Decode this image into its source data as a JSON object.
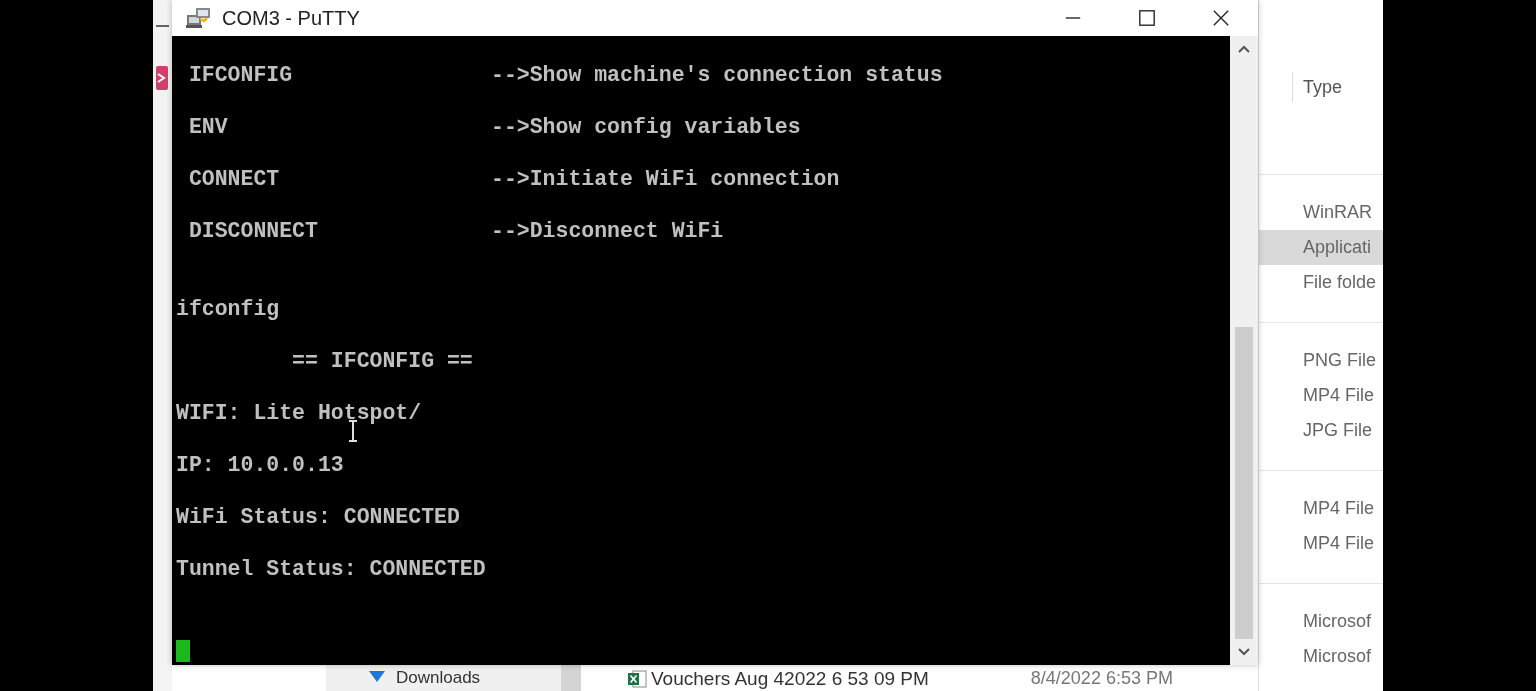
{
  "window": {
    "title": "COM3 - PuTTY"
  },
  "terminal": {
    "help_lines": [
      {
        "command": " IFCONFIG",
        "description": "-->Show machine's connection status"
      },
      {
        "command": " ENV",
        "description": "-->Show config variables"
      },
      {
        "command": " CONNECT",
        "description": "-->Initiate WiFi connection"
      },
      {
        "command": " DISCONNECT",
        "description": "-->Disconnect WiFi"
      }
    ],
    "output_lines": [
      "ifconfig",
      "         == IFCONFIG ==",
      "WIFI: Lite Hotspot/",
      "IP: 10.0.0.13",
      "WiFi Status: CONNECTED",
      "Tunnel Status: CONNECTED"
    ]
  },
  "explorer": {
    "column_header": "Type",
    "groups": [
      {
        "items": [
          {
            "label": "WinRAR",
            "selected": false
          },
          {
            "label": "Applicati",
            "selected": true
          },
          {
            "label": "File folde",
            "selected": false
          }
        ]
      },
      {
        "items": [
          {
            "label": "PNG File",
            "selected": false
          },
          {
            "label": "MP4 File",
            "selected": false
          },
          {
            "label": "JPG File",
            "selected": false
          }
        ]
      },
      {
        "items": [
          {
            "label": "MP4 File",
            "selected": false
          },
          {
            "label": "MP4 File",
            "selected": false
          }
        ]
      },
      {
        "items": [
          {
            "label": "Microsof",
            "selected": false
          },
          {
            "label": "Microsof",
            "selected": false
          }
        ]
      }
    ],
    "bottom_row": {
      "folder": "Downloads",
      "file_name": "Vouchers Aug 42022 6 53 09 PM",
      "date": "8/4/2022 6:53 PM"
    }
  }
}
